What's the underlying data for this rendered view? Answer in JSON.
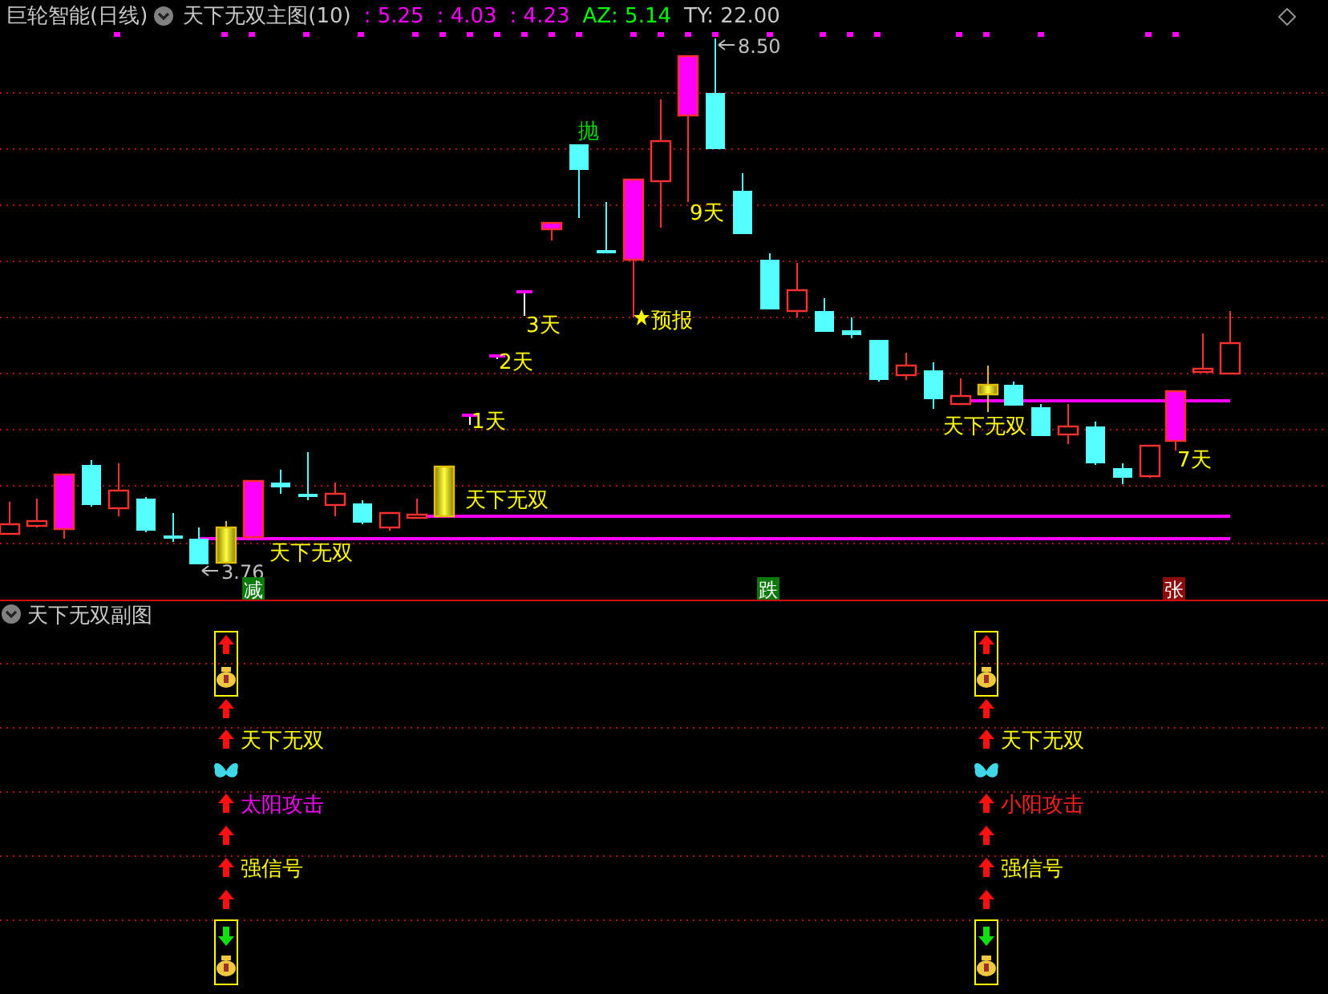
{
  "header": {
    "stock": "巨轮智能(日线)",
    "indicator": "天下无双主图(10)",
    "readings": [
      {
        "text": ": 5.25",
        "color": "#ff00ff"
      },
      {
        "text": ": 4.03",
        "color": "#ff00ff"
      },
      {
        "text": ": 4.23",
        "color": "#ff00ff"
      },
      {
        "text": "AZ: 5.14",
        "color": "#00ff00"
      },
      {
        "text": "TY: 22.00",
        "color": "#c8c8c8"
      }
    ]
  },
  "main_chart": {
    "annotations": [
      {
        "text": "8.50",
        "kind": "price"
      },
      {
        "text": "3.76",
        "kind": "price"
      },
      {
        "text": "抛",
        "kind": "sell"
      },
      {
        "text": "9天",
        "kind": "count"
      },
      {
        "text": "3天",
        "kind": "count"
      },
      {
        "text": "2天",
        "kind": "count"
      },
      {
        "text": "1天",
        "kind": "count"
      },
      {
        "text": "预报",
        "kind": "forecast"
      },
      {
        "text": "7天",
        "kind": "count"
      },
      {
        "text": "天下无双",
        "kind": "signal"
      },
      {
        "text": "天下无双",
        "kind": "signal"
      },
      {
        "text": "天下无双",
        "kind": "signal"
      }
    ],
    "badges": [
      {
        "text": "减",
        "color": "#0b7a0b"
      },
      {
        "text": "跌",
        "color": "#0b7a0b"
      },
      {
        "text": "张",
        "color": "#8b0a0a"
      }
    ]
  },
  "sub_chart": {
    "title": "天下无双副图",
    "columns": [
      {
        "markers": [
          {
            "kind": "buy_box"
          },
          {
            "kind": "up_arrow"
          },
          {
            "kind": "up_arrow",
            "label": "天下无双",
            "color": "#ffff00"
          },
          {
            "kind": "butterfly"
          },
          {
            "kind": "up_arrow",
            "label": "太阳攻击",
            "color": "#ff00ff"
          },
          {
            "kind": "up_arrow"
          },
          {
            "kind": "up_arrow",
            "label": "强信号",
            "color": "#ffff00"
          },
          {
            "kind": "up_arrow"
          },
          {
            "kind": "sell_box"
          }
        ]
      },
      {
        "markers": [
          {
            "kind": "buy_box"
          },
          {
            "kind": "up_arrow"
          },
          {
            "kind": "up_arrow",
            "label": "天下无双",
            "color": "#ffff00"
          },
          {
            "kind": "butterfly"
          },
          {
            "kind": "up_arrow",
            "label": "小阳攻击",
            "color": "#ff2020"
          },
          {
            "kind": "up_arrow"
          },
          {
            "kind": "up_arrow",
            "label": "强信号",
            "color": "#ffff00"
          },
          {
            "kind": "up_arrow"
          },
          {
            "kind": "sell_box"
          }
        ]
      }
    ]
  }
}
